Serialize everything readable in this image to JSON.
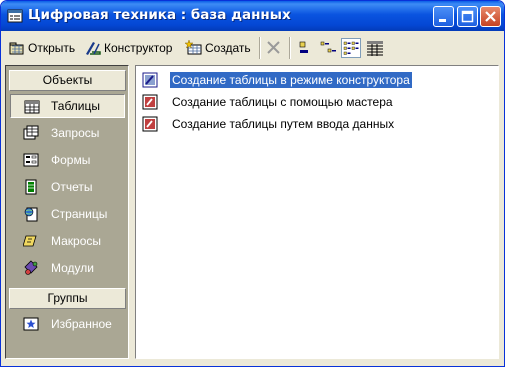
{
  "window": {
    "title": "Цифровая техника : база данных",
    "icons": {
      "app": "database-window-icon",
      "minimize": "minimize-icon",
      "maximize": "maximize-icon",
      "close": "close-icon"
    }
  },
  "toolbar": {
    "open_label": "Открыть",
    "design_label": "Конструктор",
    "create_label": "Создать",
    "icons": [
      "open-icon",
      "design-icon",
      "new-object-icon",
      "delete-icon",
      "large-icons-view-icon",
      "small-icons-view-icon",
      "list-view-icon",
      "details-view-icon"
    ],
    "active_view": "list"
  },
  "nav": {
    "objects_header": "Объекты",
    "groups_header": "Группы",
    "items": [
      {
        "label": "Таблицы",
        "icon": "table-icon",
        "selected": true
      },
      {
        "label": "Запросы",
        "icon": "query-icon",
        "selected": false
      },
      {
        "label": "Формы",
        "icon": "form-icon",
        "selected": false
      },
      {
        "label": "Отчеты",
        "icon": "report-icon",
        "selected": false
      },
      {
        "label": "Страницы",
        "icon": "page-icon",
        "selected": false
      },
      {
        "label": "Макросы",
        "icon": "macro-icon",
        "selected": false
      },
      {
        "label": "Модули",
        "icon": "module-icon",
        "selected": false
      }
    ],
    "groups": [
      {
        "label": "Избранное",
        "icon": "favorites-icon"
      }
    ]
  },
  "list": {
    "items": [
      {
        "label": "Создание таблицы в режиме конструктора",
        "icon": "create-table-designer-icon",
        "selected": true
      },
      {
        "label": "Создание таблицы с помощью мастера",
        "icon": "create-table-wizard-icon",
        "selected": false
      },
      {
        "label": "Создание таблицы путем ввода данных",
        "icon": "create-table-data-entry-icon",
        "selected": false
      }
    ]
  },
  "colors": {
    "titlebar": "#0a54e0",
    "nav_pane": "#aaa794",
    "selection": "#316ac5",
    "window_face": "#ece9d8"
  }
}
